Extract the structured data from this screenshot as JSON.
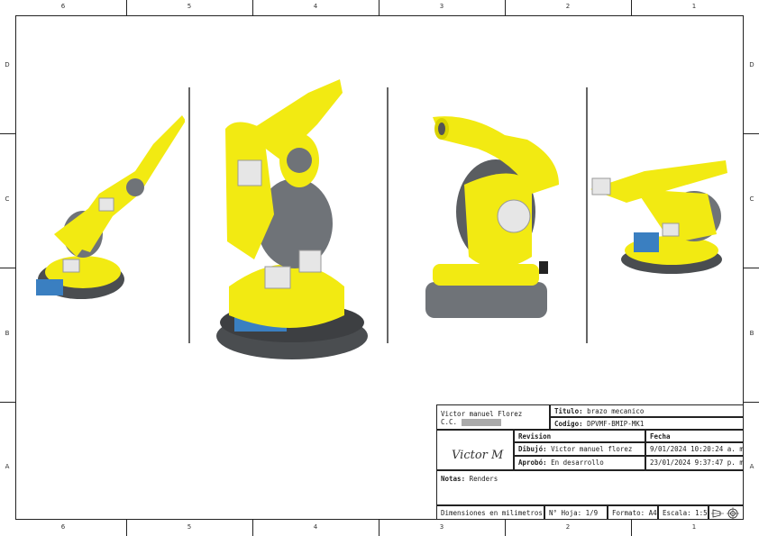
{
  "frame": {
    "columns_top": [
      "6",
      "5",
      "4",
      "3",
      "2",
      "1"
    ],
    "columns_bottom": [
      "6",
      "5",
      "4",
      "3",
      "2",
      "1"
    ],
    "rows_left": [
      "D",
      "C",
      "B",
      "A"
    ],
    "rows_right": [
      "D",
      "C",
      "B",
      "A"
    ]
  },
  "title_block": {
    "author_name": "Victor manuel Florez",
    "author_id_label": "C.C.",
    "title_label": "Titulo:",
    "title_value": "brazo mecanico",
    "code_label": "Codigo:",
    "code_value": "DPVMF-BMIP-MK1",
    "revision_label": "Revision",
    "date_header": "Fecha",
    "drawn_label": "Dibujó:",
    "drawn_value": "Victor manuel florez",
    "drawn_date": "9/01/2024 10:20:24 a. m.",
    "approved_label": "Aprobó:",
    "approved_value": "En desarrollo",
    "approved_date": "23/01/2024 9:37:47 p. m.",
    "signature_text": "Victor M",
    "notes_label": "Notas:",
    "notes_value": "Renders",
    "units": "Dimensiones en milimetros",
    "sheet_label": "N° Hoja:",
    "sheet_value": "1/9",
    "format_label": "Formato:",
    "format_value": "A4",
    "scale_label": "Escala:",
    "scale_value": "1:5"
  },
  "colors": {
    "robot_yellow": "#f2ea12",
    "robot_grey": "#6f7378",
    "base_dark": "#4a4d50"
  },
  "icons": [
    "projection-symbol-icon"
  ]
}
